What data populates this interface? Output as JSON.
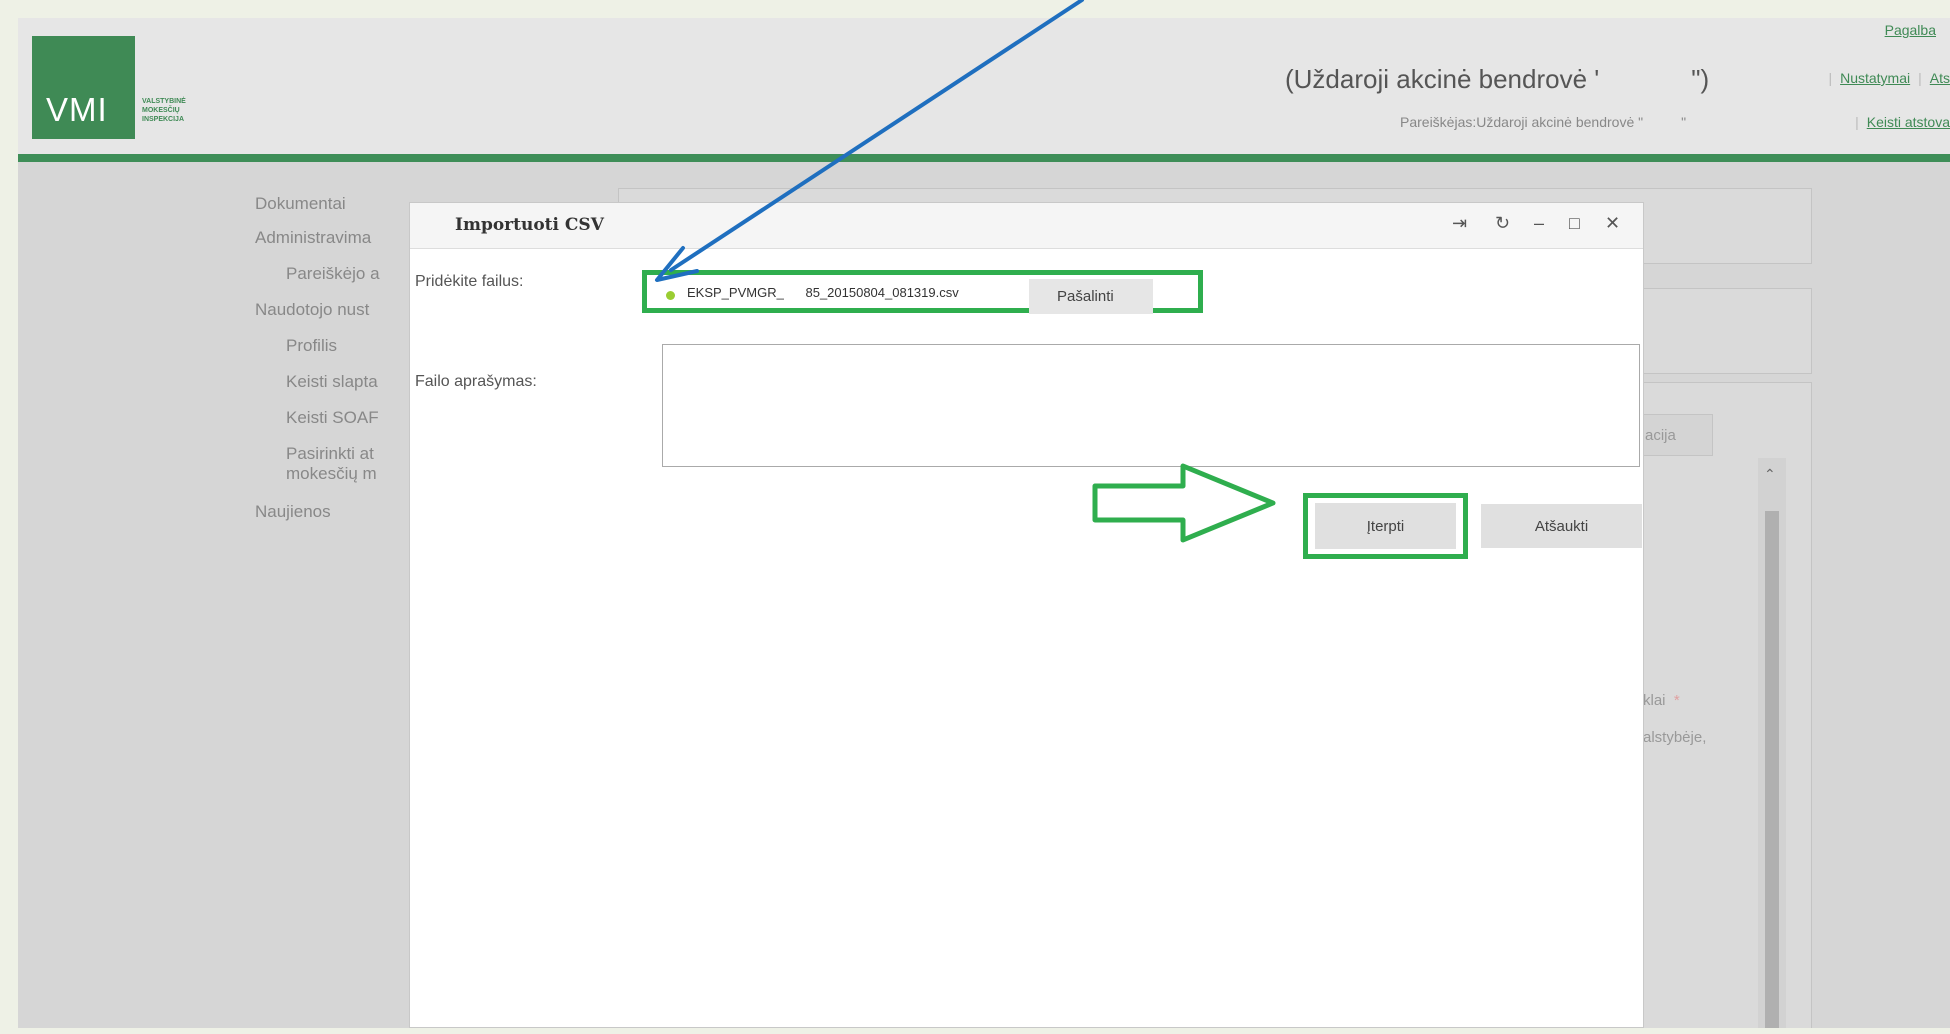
{
  "header": {
    "help_link": "Pagalba",
    "company_title": "(Uždaroji akcinė bendrovė '",
    "company_title_end": "\")",
    "settings_link": "Nustatymai",
    "truncated_link": "Ats",
    "applicant": "Pareiškėjas:Uždaroji akcinė bendrovė \"",
    "applicant_end": "\"",
    "change_rep_link": "Keisti atstova"
  },
  "logo": {
    "abbr": "VMI",
    "line1": "VALSTYBINĖ",
    "line2": "MOKESČIŲ",
    "line3": "INSPEKCIJA"
  },
  "sidebar": {
    "items": [
      {
        "label": "Dokumentai"
      },
      {
        "label": "Administravima"
      },
      {
        "label": "Pareiškėjo a"
      },
      {
        "label": "Naudotojo nust"
      },
      {
        "label": "Profilis"
      },
      {
        "label": "Keisti slapta"
      },
      {
        "label": "Keisti SOAF"
      },
      {
        "label": "Pasirinkti at"
      },
      {
        "label": "mokesčių m"
      },
      {
        "label": "Naujienos"
      }
    ]
  },
  "background": {
    "tab_label": "acija",
    "field_label": "klai",
    "required_mark": "*",
    "text_fragment": "alstybėje,"
  },
  "dialog": {
    "title": "Importuoti CSV",
    "controls": {
      "pin": "⇥",
      "refresh": "↻",
      "minimize": "–",
      "maximize": "□",
      "close": "✕"
    },
    "add_files_label": "Pridėkite failus:",
    "file_name": "EKSP_PVMGR_      85_20150804_081319.csv",
    "remove_button": "Pašalinti",
    "description_label": "Failo aprašymas:",
    "description_value": "",
    "insert_button": "Įterpti",
    "cancel_button": "Atšaukti"
  },
  "annotation_colors": {
    "pointer_arrow": "#1f6fbf",
    "highlight": "#2fae4e"
  }
}
